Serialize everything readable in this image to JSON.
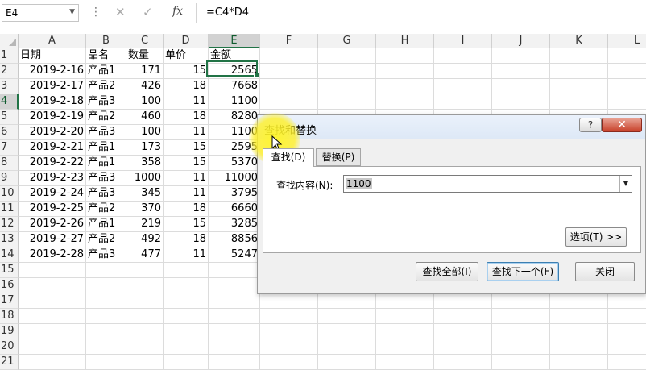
{
  "formula_bar": {
    "name_box": "E4",
    "formula": "=C4*D4",
    "fx_label": "fx"
  },
  "sheet": {
    "columns": [
      "A",
      "B",
      "C",
      "D",
      "E",
      "F",
      "G",
      "H",
      "I",
      "J",
      "K",
      "L"
    ],
    "row_numbers": [
      "1",
      "2",
      "3",
      "4",
      "5",
      "6",
      "7",
      "8",
      "9",
      "10",
      "11",
      "12",
      "13",
      "14",
      "15",
      "16",
      "17",
      "18",
      "19",
      "20",
      "21"
    ],
    "headers": [
      "日期",
      "品名",
      "数量",
      "单价",
      "金额"
    ],
    "rows": [
      [
        "2019-2-16",
        "产品1",
        "171",
        "15",
        "2565"
      ],
      [
        "2019-2-17",
        "产品2",
        "426",
        "18",
        "7668"
      ],
      [
        "2019-2-18",
        "产品3",
        "100",
        "11",
        "1100"
      ],
      [
        "2019-2-19",
        "产品2",
        "460",
        "18",
        "8280"
      ],
      [
        "2019-2-20",
        "产品3",
        "100",
        "11",
        "1100"
      ],
      [
        "2019-2-21",
        "产品1",
        "173",
        "15",
        "2595"
      ],
      [
        "2019-2-22",
        "产品1",
        "358",
        "15",
        "5370"
      ],
      [
        "2019-2-23",
        "产品3",
        "1000",
        "11",
        "11000"
      ],
      [
        "2019-2-24",
        "产品3",
        "345",
        "11",
        "3795"
      ],
      [
        "2019-2-25",
        "产品2",
        "370",
        "18",
        "6660"
      ],
      [
        "2019-2-26",
        "产品1",
        "219",
        "15",
        "3285"
      ],
      [
        "2019-2-27",
        "产品2",
        "492",
        "18",
        "8856"
      ],
      [
        "2019-2-28",
        "产品3",
        "477",
        "11",
        "5247"
      ]
    ],
    "active_cell": "E4"
  },
  "dialog": {
    "title": "查找和替换",
    "help": "?",
    "close": "✕",
    "tab_find": "查找(D)",
    "tab_replace": "替换(P)",
    "find_label": "查找内容(N):",
    "find_value": "1100",
    "options_button": "选项(T) >>",
    "find_all_button": "查找全部(I)",
    "find_next_button": "查找下一个(F)",
    "close_button": "关闭"
  },
  "colors": {
    "accent": "#217346",
    "highlight": "#fff028"
  }
}
